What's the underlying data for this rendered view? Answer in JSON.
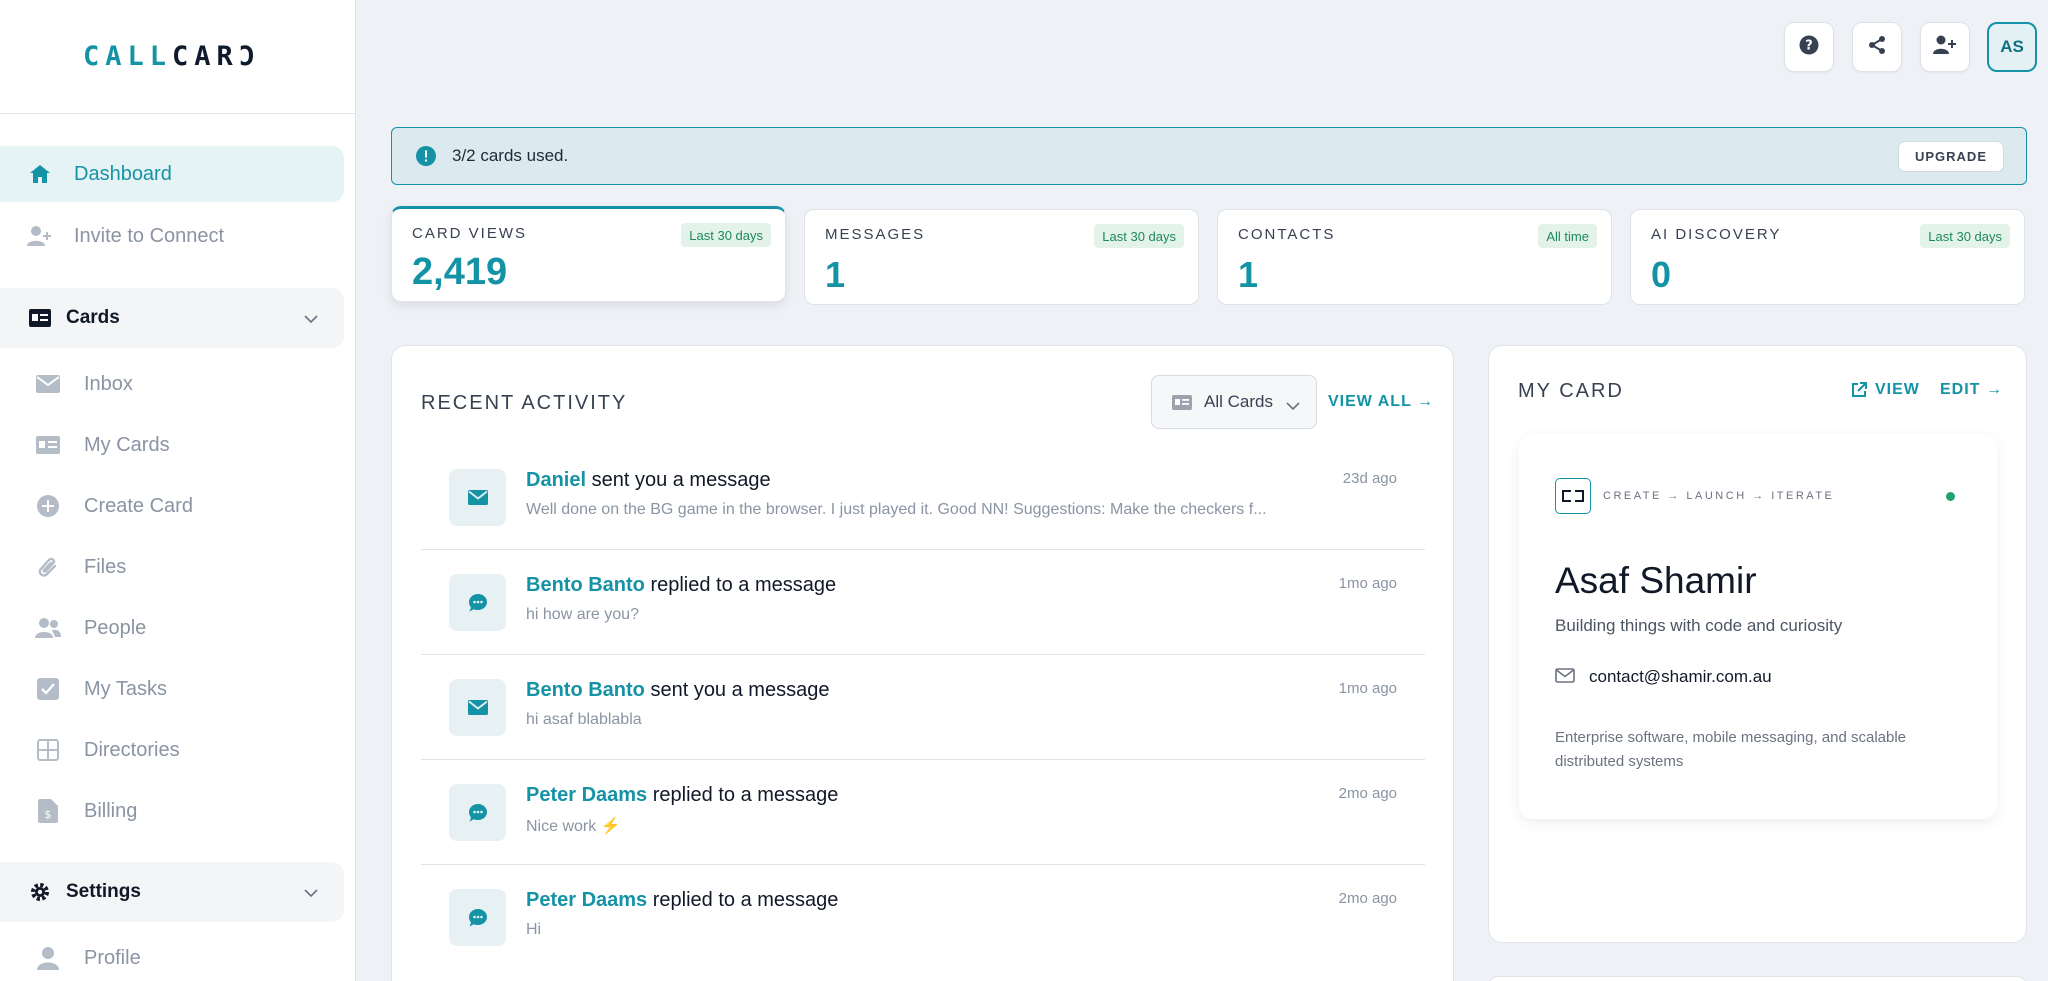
{
  "brand": {
    "logo_accent": "CALL",
    "logo_rest": "CARƆ"
  },
  "colors": {
    "accent": "#1593a6",
    "badge_green": "#1b8a5a",
    "online": "#22a36b"
  },
  "sidebar": {
    "primary": [
      {
        "label": "Dashboard",
        "icon": "home-icon",
        "active": true
      },
      {
        "label": "Invite to Connect",
        "icon": "user-plus-icon"
      }
    ],
    "cards_section": {
      "label": "Cards",
      "icon": "id-card-icon"
    },
    "cards_items": [
      {
        "label": "Inbox",
        "icon": "envelope-icon"
      },
      {
        "label": "My Cards",
        "icon": "id-card-icon"
      },
      {
        "label": "Create Card",
        "icon": "plus-circle-icon"
      },
      {
        "label": "Files",
        "icon": "paperclip-icon"
      },
      {
        "label": "People",
        "icon": "users-icon"
      },
      {
        "label": "My Tasks",
        "icon": "checkbox-icon"
      },
      {
        "label": "Directories",
        "icon": "grid-icon"
      },
      {
        "label": "Billing",
        "icon": "invoice-icon"
      }
    ],
    "settings_section": {
      "label": "Settings",
      "icon": "gear-icon"
    },
    "settings_items": [
      {
        "label": "Profile",
        "icon": "user-icon"
      }
    ]
  },
  "topbar": {
    "avatar_initials": "AS",
    "icons": [
      "help-icon",
      "share-icon",
      "add-user-icon"
    ]
  },
  "alert": {
    "text": "3/2 cards used.",
    "button": "UPGRADE"
  },
  "stats": [
    {
      "label": "CARD VIEWS",
      "badge": "Last 30 days",
      "value": "2,419"
    },
    {
      "label": "MESSAGES",
      "badge": "Last 30 days",
      "value": "1"
    },
    {
      "label": "CONTACTS",
      "badge": "All time",
      "value": "1"
    },
    {
      "label": "AI DISCOVERY",
      "badge": "Last 30 days",
      "value": "0"
    }
  ],
  "activity": {
    "title": "RECENT ACTIVITY",
    "filter": "All Cards",
    "view_all": "VIEW ALL →",
    "items": [
      {
        "name": "Daniel",
        "action": "sent you a message",
        "preview": "Well done on the BG game in the browser. I just played it. Good NN! Suggestions: Make the checkers f...",
        "time": "23d ago",
        "icon": "envelope-icon"
      },
      {
        "name": "Bento Banto",
        "action": "replied to a message",
        "preview": "hi how are you?",
        "time": "1mo ago",
        "icon": "chat-icon"
      },
      {
        "name": "Bento Banto",
        "action": "sent you a message",
        "preview": "hi asaf blablabla",
        "time": "1mo ago",
        "icon": "envelope-icon"
      },
      {
        "name": "Peter Daams",
        "action": "replied to a message",
        "preview": "Nice work ⚡",
        "time": "2mo ago",
        "icon": "chat-icon"
      },
      {
        "name": "Peter Daams",
        "action": "replied to a message",
        "preview": "Hi",
        "time": "2mo ago",
        "icon": "chat-icon"
      }
    ]
  },
  "my_card": {
    "title": "MY CARD",
    "view": "VIEW",
    "edit": "EDIT →",
    "tagline": "CREATE → LAUNCH → ITERATE",
    "name": "Asaf Shamir",
    "role": "Building things with code and curiosity",
    "email": "contact@shamir.com.au",
    "description": "Enterprise software, mobile messaging, and scalable distributed systems"
  }
}
